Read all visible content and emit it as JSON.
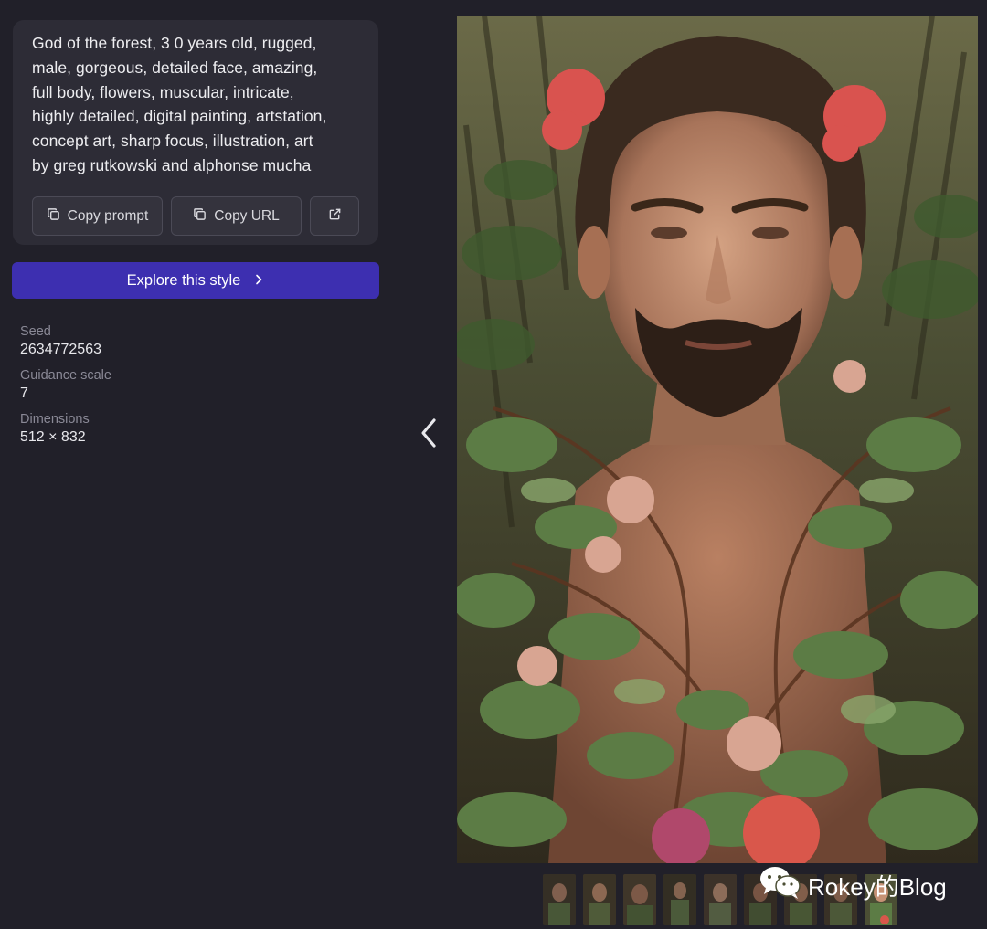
{
  "prompt": {
    "lines": [
      "God of the forest, 3 0 years old, rugged,",
      "male, gorgeous, detailed face, amazing,",
      "full body, flowers, muscular, intricate,",
      "highly detailed, digital painting, artstation,",
      "concept art, sharp focus, illustration, art",
      "by greg rutkowski and alphonse mucha"
    ]
  },
  "actions": {
    "copy_prompt": "Copy prompt",
    "copy_url": "Copy URL",
    "open_external_icon": "external-link-icon"
  },
  "explore": {
    "label": "Explore this style"
  },
  "meta": {
    "seed_label": "Seed",
    "seed_value": "2634772563",
    "guidance_label": "Guidance scale",
    "guidance_value": "7",
    "dimensions_label": "Dimensions",
    "dimensions_value": "512 × 832"
  },
  "viewer": {
    "prev_icon": "chevron-left-icon",
    "thumbnail_count": 9,
    "active_thumbnail": 9
  },
  "watermark": {
    "text": "Rokey的Blog"
  },
  "colors": {
    "background": "#212029",
    "card": "#2d2c36",
    "accent": "#3d2fb0"
  }
}
